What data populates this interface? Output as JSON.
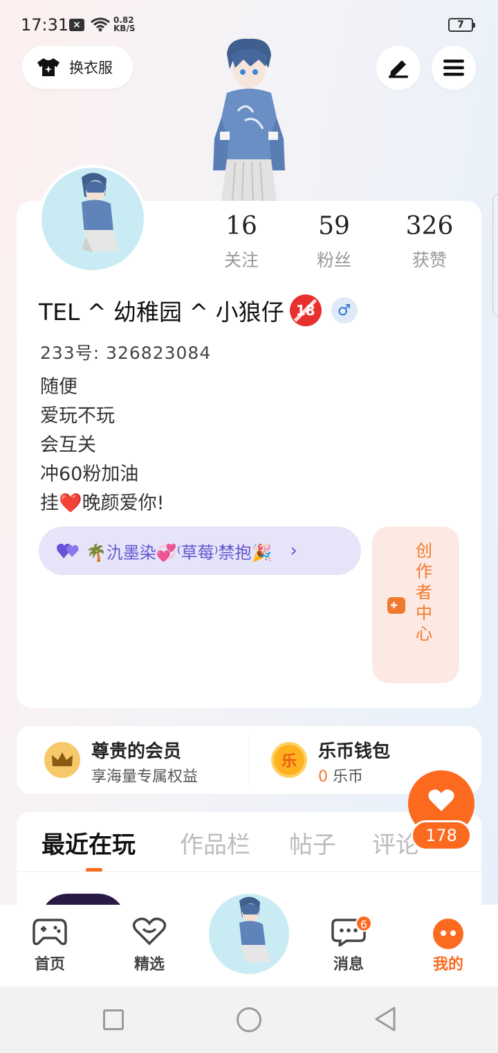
{
  "status_bar": {
    "time": "17:31",
    "net_speed_value": "0.82",
    "net_speed_unit": "KB/S",
    "battery": "7"
  },
  "top_bar": {
    "outfit_label": "换衣服"
  },
  "profile": {
    "stats": [
      {
        "value": "16",
        "label": "关注"
      },
      {
        "value": "59",
        "label": "粉丝"
      },
      {
        "value": "326",
        "label": "获赞"
      }
    ],
    "username": "TEL ^ 幼稚园 ^ 小狼仔",
    "id_line": "233号: 326823084",
    "bio_lines": [
      "随便",
      "爱玩不玩",
      "会互关",
      "冲60粉加油",
      "挂❤️晚颜爱你!"
    ],
    "guild_chip": "🌴氿墨染💞⁽草莓⁾禁抱🎉",
    "creator_label": "创作者中心"
  },
  "membership": {
    "title": "尊贵的会员",
    "subtitle": "享海量专属权益"
  },
  "wallet": {
    "title": "乐币钱包",
    "coin_glyph": "乐",
    "amount": "0",
    "unit": "乐币"
  },
  "like": {
    "count": "178"
  },
  "tabs": [
    "最近在玩",
    "作品栏",
    "帖子",
    "评论"
  ],
  "bottom_nav": {
    "items": [
      {
        "label": "首页"
      },
      {
        "label": "精选"
      },
      {
        "label": "消息",
        "badge": "6"
      },
      {
        "label": "我的"
      }
    ]
  },
  "colors": {
    "accent": "#fb6a1e",
    "chip_text": "#6454d0",
    "avatar_bg": "#c9ecf4"
  }
}
